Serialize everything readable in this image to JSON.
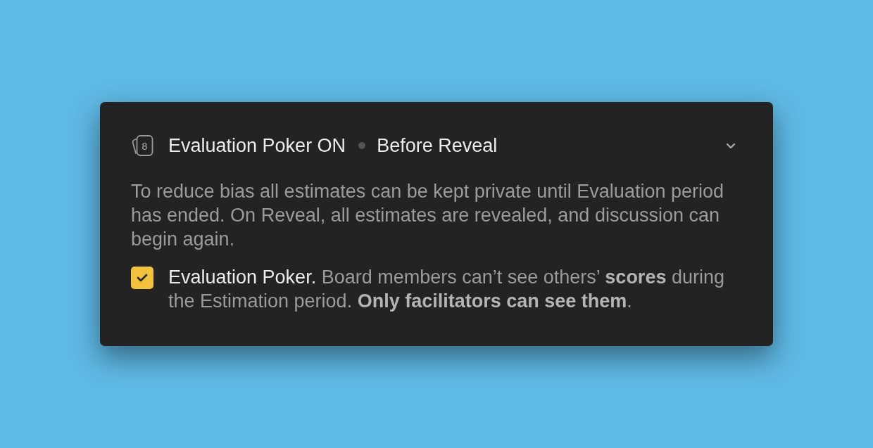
{
  "panel": {
    "expanded": true,
    "header": {
      "card_value": "8",
      "title": "Evaluation Poker ON",
      "status": "Before Reveal"
    },
    "description": "To reduce bias all estimates can be kept private until Evaluation period has ended. On Reveal, all estimates are revealed, and discussion can begin again.",
    "option": {
      "checked": true,
      "title": "Evaluation Poker.",
      "text": "Board members can’t see others’ **scores** during the Estimation period. **Only facilitators can see them**."
    }
  }
}
